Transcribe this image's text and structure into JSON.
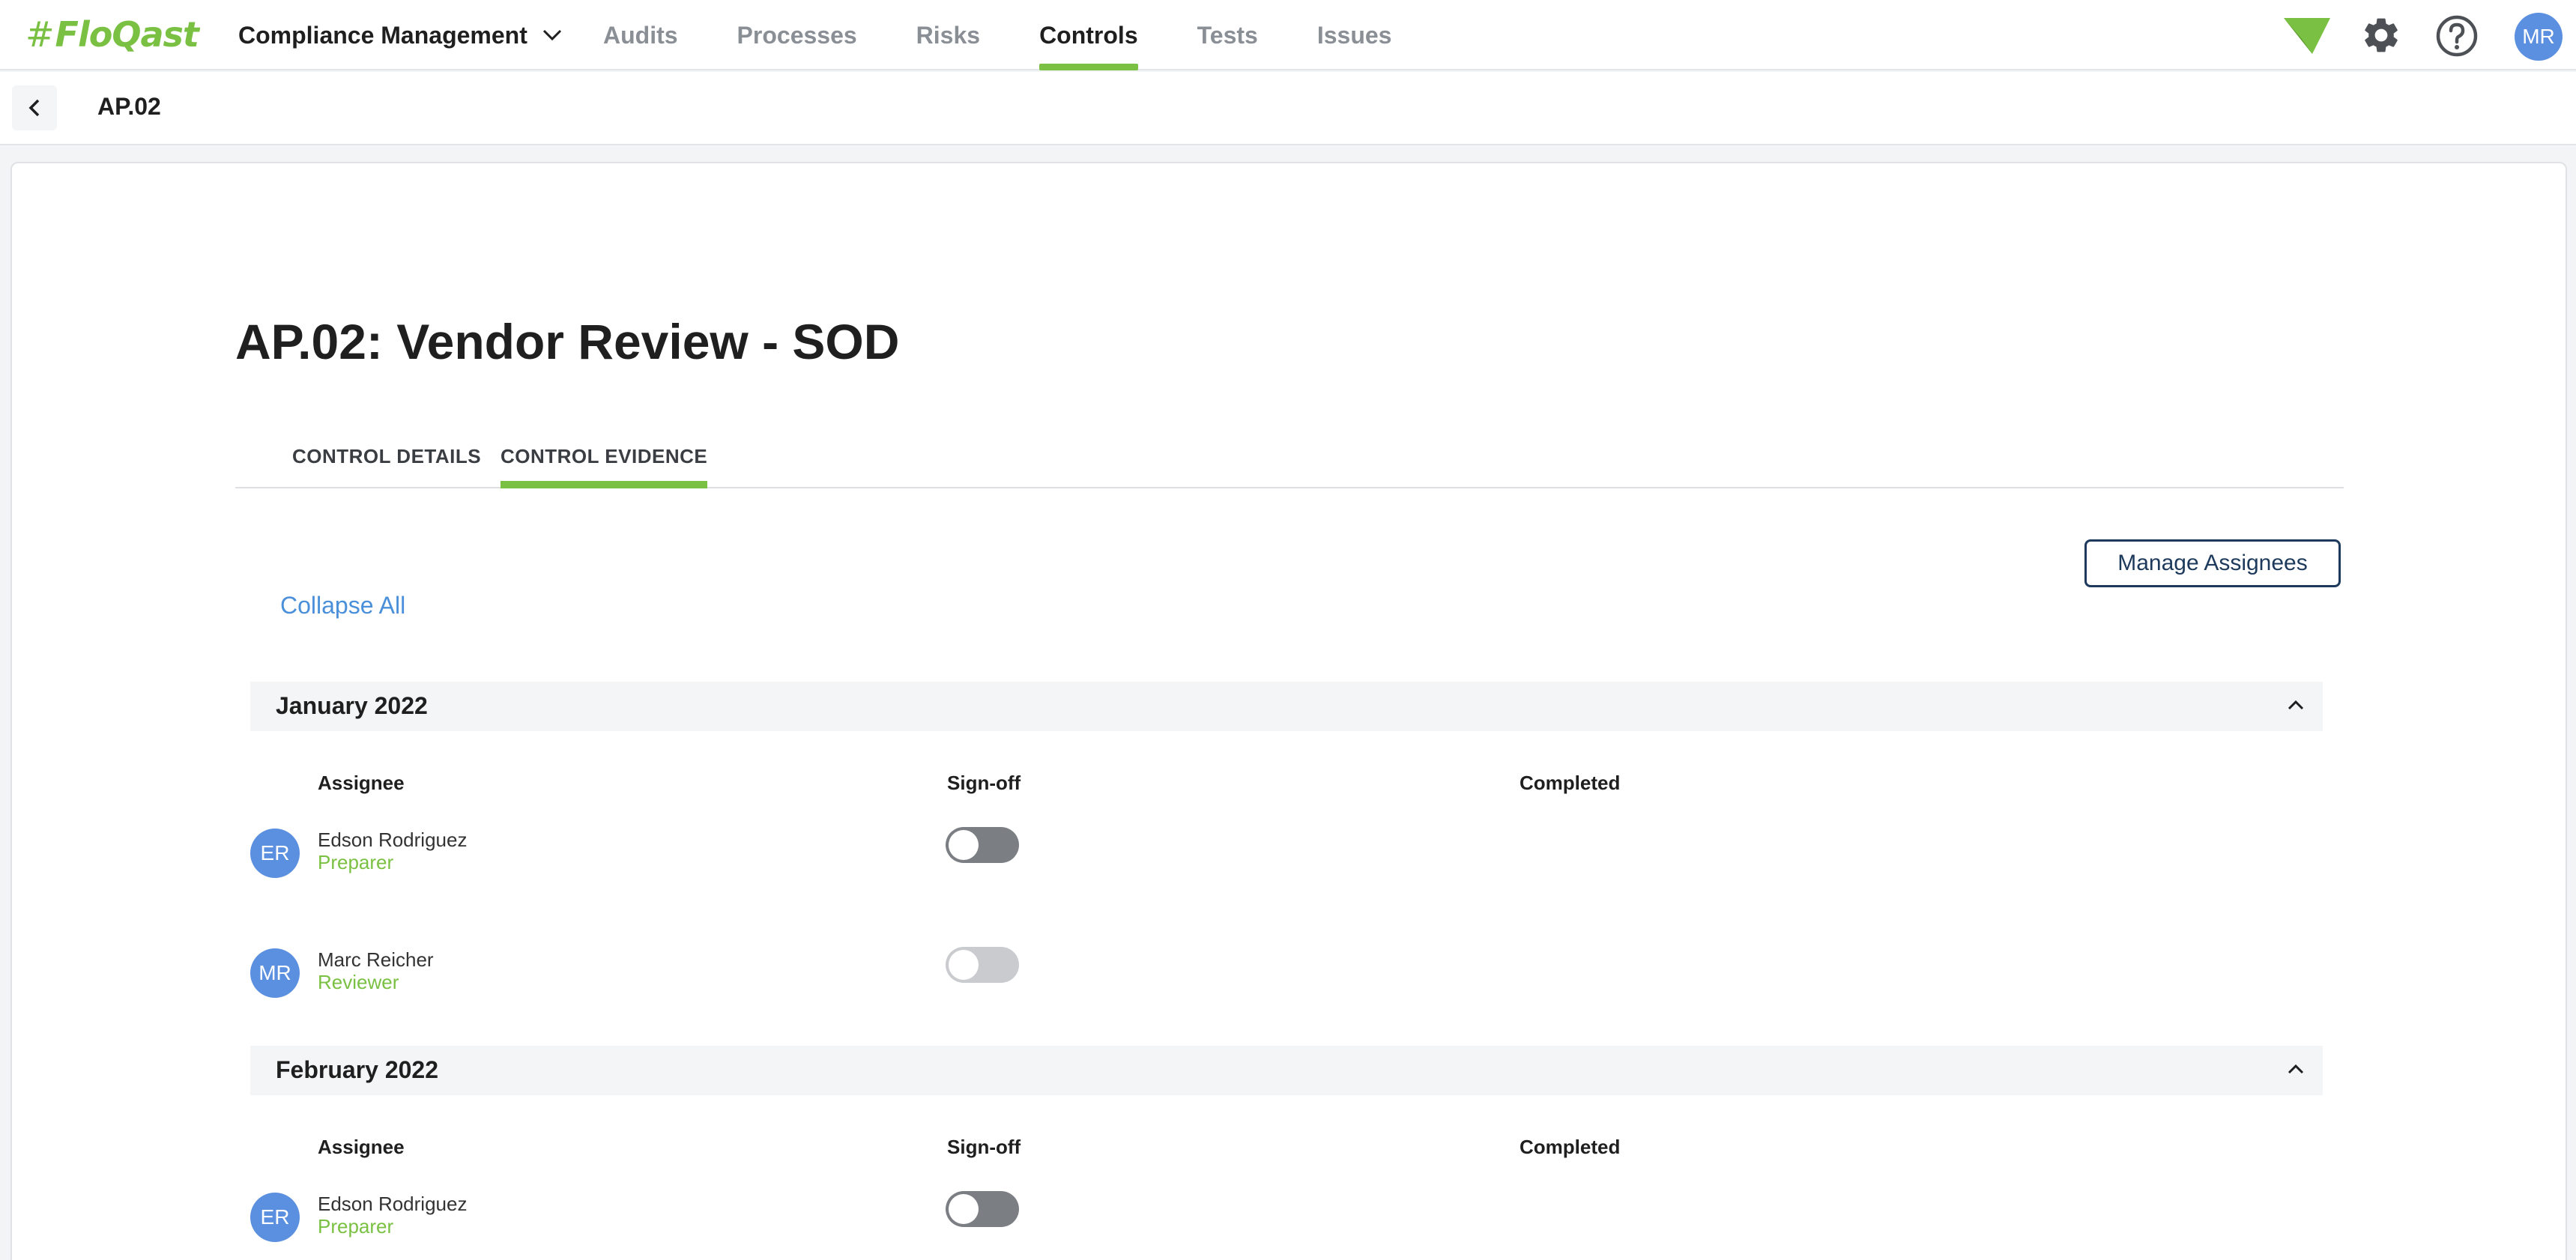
{
  "app": {
    "logo_hash": "#",
    "logo_text": "FloQast"
  },
  "header": {
    "module": "Compliance Management",
    "nav": [
      {
        "label": "Audits",
        "active": false
      },
      {
        "label": "Processes",
        "active": false
      },
      {
        "label": "Risks",
        "active": false
      },
      {
        "label": "Controls",
        "active": true
      },
      {
        "label": "Tests",
        "active": false
      },
      {
        "label": "Issues",
        "active": false
      }
    ],
    "icons": [
      "flag-icon",
      "gear-icon",
      "help-icon"
    ],
    "user_initials": "MR"
  },
  "breadcrumb": {
    "current": "AP.02"
  },
  "page": {
    "title": "AP.02: Vendor Review - SOD",
    "tabs": [
      {
        "label": "CONTROL DETAILS",
        "active": false
      },
      {
        "label": "CONTROL EVIDENCE",
        "active": true
      }
    ],
    "manage_assignees": "Manage Assignees",
    "collapse_all": "Collapse All"
  },
  "columns": {
    "assignee": "Assignee",
    "signoff": "Sign-off",
    "completed": "Completed"
  },
  "sections": [
    {
      "label": "January 2022",
      "rows": [
        {
          "initials": "ER",
          "name": "Edson Rodriguez",
          "role": "Preparer",
          "signoff": false,
          "enabled": true
        },
        {
          "initials": "MR",
          "name": "Marc Reicher",
          "role": "Reviewer",
          "signoff": false,
          "enabled": false
        }
      ]
    },
    {
      "label": "February 2022",
      "rows": [
        {
          "initials": "ER",
          "name": "Edson Rodriguez",
          "role": "Preparer",
          "signoff": false,
          "enabled": true
        }
      ]
    }
  ],
  "colors": {
    "accent": "#7ac143",
    "link": "#4a8fd9",
    "avatar": "#5b8fdf",
    "button_border": "#1d3a5c"
  }
}
